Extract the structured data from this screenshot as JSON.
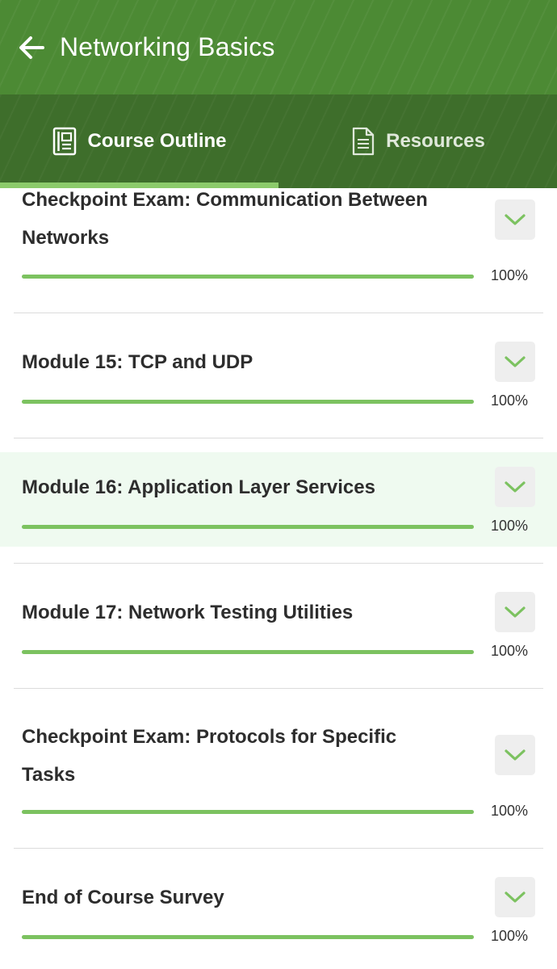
{
  "header": {
    "title": "Networking Basics",
    "back_icon": "arrow-left-icon"
  },
  "tabs": [
    {
      "label": "Course Outline",
      "icon": "course-outline-icon",
      "active": true
    },
    {
      "label": "Resources",
      "icon": "document-icon",
      "active": false
    }
  ],
  "colors": {
    "app_bar": "#4c8a34",
    "tab_bar": "#3e6e2b",
    "tab_indicator": "#8ccb6b",
    "progress_fill": "#7cc260",
    "highlight_row": "#effaf0"
  },
  "outline": {
    "items": [
      {
        "title_line1": "Checkpoint Exam: Communication Between",
        "title_line2": "Networks",
        "progress": 1.0,
        "progress_label": "100%",
        "highlighted": false
      },
      {
        "title_line1": "Module 15: TCP and UDP",
        "progress": 1.0,
        "progress_label": "100%",
        "highlighted": false
      },
      {
        "title_line1": "Module 16: Application Layer Services",
        "progress": 1.0,
        "progress_label": "100%",
        "highlighted": true
      },
      {
        "title_line1": "Module 17: Network Testing Utilities",
        "progress": 1.0,
        "progress_label": "100%",
        "highlighted": false
      },
      {
        "title_line1": "Checkpoint Exam: Protocols for Specific",
        "title_line2": "Tasks",
        "progress": 1.0,
        "progress_label": "100%",
        "highlighted": false
      },
      {
        "title_line1": "End of Course Survey",
        "progress": 1.0,
        "progress_label": "100%",
        "highlighted": false
      }
    ],
    "expand_icon": "chevron-down-icon"
  }
}
